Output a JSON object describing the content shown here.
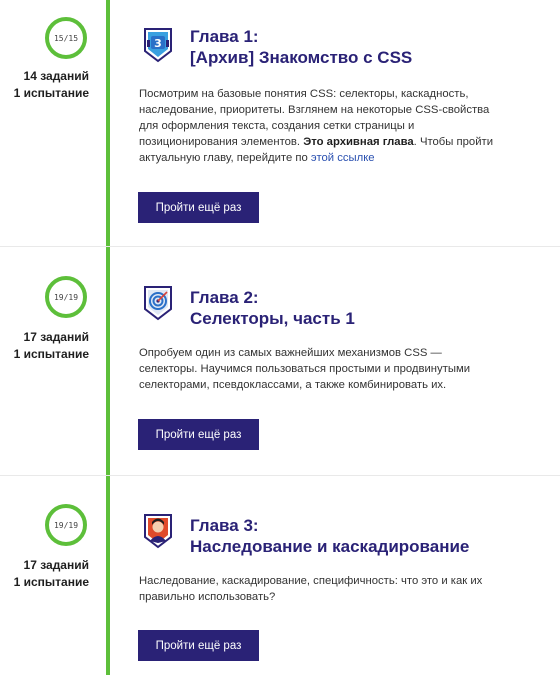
{
  "chapters": [
    {
      "progress": "15/15",
      "tasks": "14 заданий",
      "trials": "1 испытание",
      "title_line1": "Глава 1:",
      "title_line2": "[Архив] Знакомство с CSS",
      "desc_main": "Посмотрим на базовые понятия CSS: селекторы, каскадность, наследование, приоритеты. Взглянем на некоторые CSS-свойства для оформления текста, создания сетки страницы и позиционирования элементов. ",
      "desc_bold": "Это архивная глава",
      "desc_after": ". Чтобы пройти актуальную главу, перейдите по ",
      "desc_link": "этой ссылке",
      "button": "Пройти ещё раз",
      "icon": "css-shield-icon"
    },
    {
      "progress": "19/19",
      "tasks": "17 заданий",
      "trials": "1 испытание",
      "title_line1": "Глава 2:",
      "title_line2": "Селекторы, часть 1",
      "desc_main": "Опробуем один из самых важнейших механизмов CSS — селекторы. Научимся пользоваться простыми и продвинутыми селекторами, псевдоклассами, а также комбинировать их.",
      "button": "Пройти ещё раз",
      "icon": "target-shield-icon"
    },
    {
      "progress": "19/19",
      "tasks": "17 заданий",
      "trials": "1 испытание",
      "title_line1": "Глава 3:",
      "title_line2": "Наследование и каскадирование",
      "desc_main": "Наследование, каскадирование, специфичность: что это и как их правильно использовать?",
      "button": "Пройти ещё раз",
      "icon": "character-shield-icon"
    }
  ],
  "colors": {
    "timeline": "#5dbf3a",
    "title": "#2a2276",
    "button": "#2a2276",
    "link": "#2a50b0"
  }
}
